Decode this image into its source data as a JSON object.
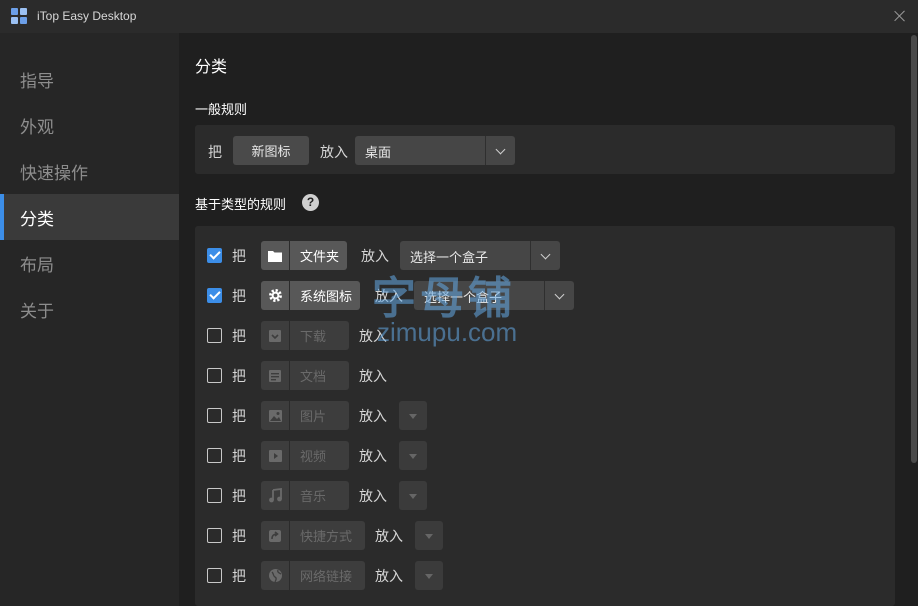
{
  "window": {
    "title": "iTop Easy Desktop"
  },
  "sidebar": {
    "items": [
      {
        "label": "指导"
      },
      {
        "label": "外观"
      },
      {
        "label": "快速操作"
      },
      {
        "label": "分类"
      },
      {
        "label": "布局"
      },
      {
        "label": "关于"
      }
    ],
    "active": "分类"
  },
  "page": {
    "title": "分类",
    "general_rules_title": "一般规则",
    "type_rules_title": "基于类型的规则",
    "help_symbol": "?"
  },
  "general_rule": {
    "prefix": "把",
    "item": "新图标",
    "put_label": "放入",
    "target": "桌面"
  },
  "type_rules": [
    {
      "checked": true,
      "prefix": "把",
      "label": "文件夹",
      "icon": "folder-icon",
      "put_label": "放入",
      "target": "选择一个盒子",
      "enabled": true
    },
    {
      "checked": true,
      "prefix": "把",
      "label": "系统图标",
      "icon": "gear-icon",
      "put_label": "放入",
      "target": "选择一个盒子",
      "enabled": true
    },
    {
      "checked": false,
      "prefix": "把",
      "label": "下载",
      "icon": "download-icon",
      "put_label": "放入",
      "enabled": false
    },
    {
      "checked": false,
      "prefix": "把",
      "label": "文档",
      "icon": "document-icon",
      "put_label": "放入",
      "enabled": false
    },
    {
      "checked": false,
      "prefix": "把",
      "label": "图片",
      "icon": "image-icon",
      "put_label": "放入",
      "enabled": false
    },
    {
      "checked": false,
      "prefix": "把",
      "label": "视频",
      "icon": "video-icon",
      "put_label": "放入",
      "enabled": false
    },
    {
      "checked": false,
      "prefix": "把",
      "label": "音乐",
      "icon": "music-icon",
      "put_label": "放入",
      "enabled": false
    },
    {
      "checked": false,
      "prefix": "把",
      "label": "快捷方式",
      "icon": "shortcut-icon",
      "put_label": "放入",
      "enabled": false
    },
    {
      "checked": false,
      "prefix": "把",
      "label": "网络链接",
      "icon": "globe-icon",
      "put_label": "放入",
      "enabled": false
    }
  ],
  "watermark": {
    "line1": "字母铺",
    "line2": "zimupu.com"
  },
  "colors": {
    "accent": "#3c8ee8",
    "background": "#1f1f1f",
    "sidebar": "#262626",
    "panel": "#2b2b2b"
  }
}
